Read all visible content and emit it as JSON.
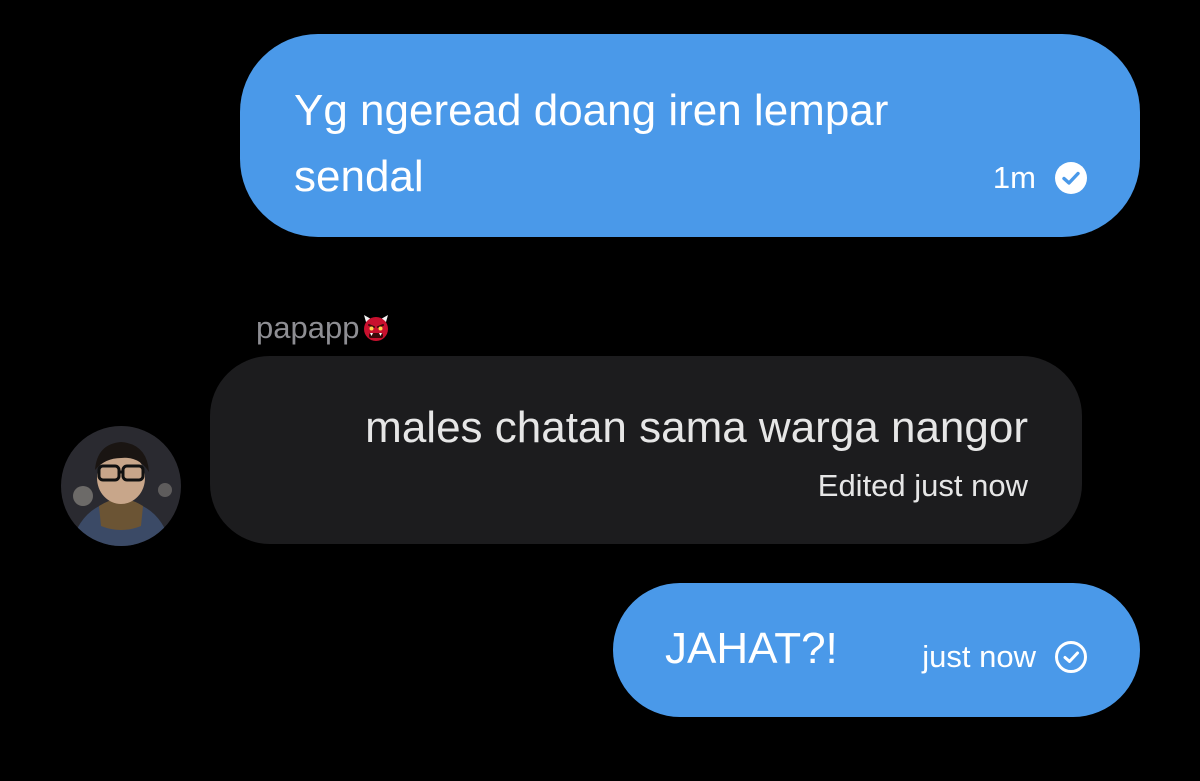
{
  "messages": [
    {
      "direction": "sent",
      "text": "Yg ngeread doang iren lempar sendal",
      "time": "1m",
      "status_icon": "check-circle-filled-icon"
    },
    {
      "direction": "received",
      "sender": "papapp",
      "sender_emoji": "ogre-emoji",
      "text": "males chatan sama warga nangor",
      "edited_label": "Edited just now",
      "avatar_icon": "user-avatar"
    },
    {
      "direction": "sent",
      "text": "JAHAT?!",
      "time": "just now",
      "status_icon": "check-circle-outline-icon"
    }
  ],
  "colors": {
    "background": "#000000",
    "sent_bubble": "#4a99e9",
    "received_bubble": "#1c1c1e",
    "sender_name": "#8e8e93"
  }
}
